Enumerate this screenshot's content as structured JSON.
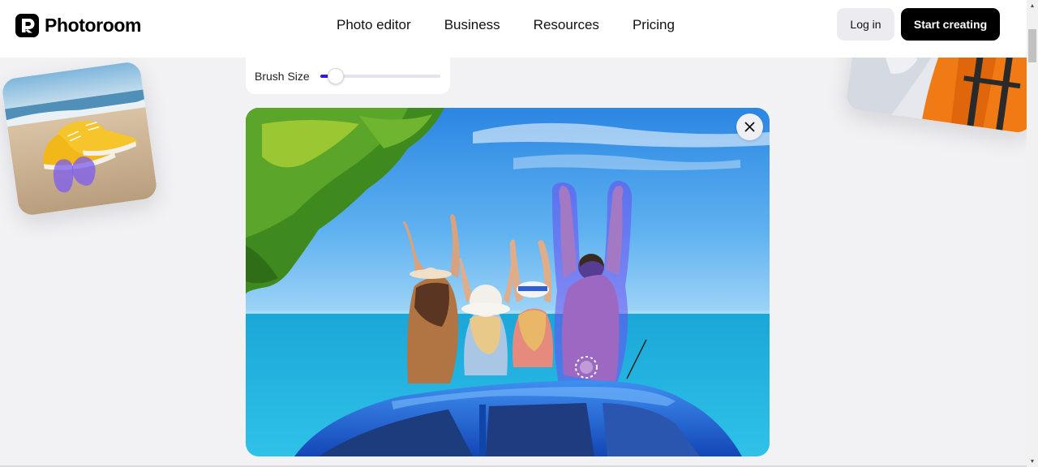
{
  "header": {
    "brand": "Photoroom",
    "nav": [
      "Photo editor",
      "Business",
      "Resources",
      "Pricing"
    ],
    "login_label": "Log in",
    "start_label": "Start creating"
  },
  "brush": {
    "label": "Brush Size",
    "value_fraction": 0.13
  },
  "icons": {
    "logo": "photoroom-logo-icon",
    "close": "close-icon",
    "scroll_up": "scroll-up-arrow-icon",
    "scroll_down": "scroll-down-arrow-icon"
  },
  "colors": {
    "accent": "#3a14e0",
    "primary_button": "#000000",
    "secondary_button": "#ececf0",
    "page_background": "#f2f2f5",
    "mask_overlay": "#6b4cf0"
  }
}
